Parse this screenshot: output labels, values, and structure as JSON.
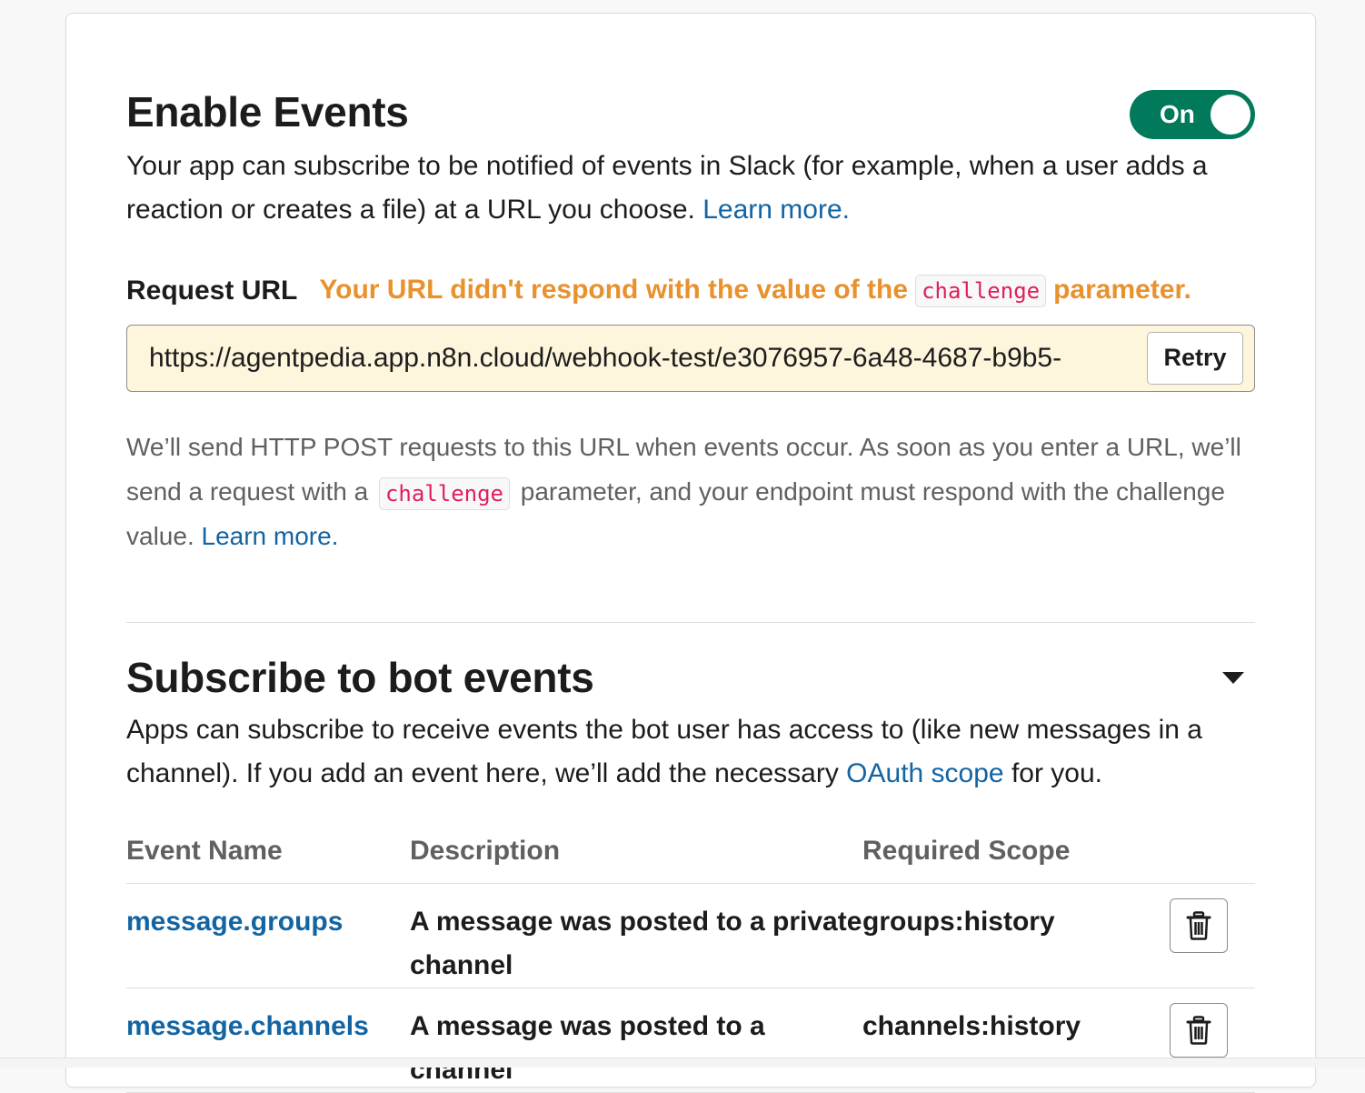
{
  "enable_events": {
    "title": "Enable Events",
    "toggle_label": "On",
    "desc_text": "Your app can subscribe to be notified of events in Slack (for example, when a user adds a reaction or creates a file) at a URL you choose.",
    "learn_more": "Learn more."
  },
  "request_url": {
    "label": "Request URL",
    "warning_before": "Your URL didn't respond with the value of the",
    "warning_code": "challenge",
    "warning_after": "parameter.",
    "value": "https://agentpedia.app.n8n.cloud/webhook-test/e3076957-6a48-4687-b9b5-",
    "retry_label": "Retry",
    "help_before": "We’ll send HTTP POST requests to this URL when events occur. As soon as you enter a URL, we’ll send a request with a",
    "help_code": "challenge",
    "help_after": "parameter, and your endpoint must respond with the challenge value.",
    "help_learn_more": "Learn more."
  },
  "bot_events": {
    "title": "Subscribe to bot events",
    "desc_before": "Apps can subscribe to receive events the bot user has access to (like new messages in a channel). If you add an event here, we’ll add the necessary",
    "desc_link": "OAuth scope",
    "desc_after": "for you.",
    "columns": [
      "Event Name",
      "Description",
      "Required Scope"
    ],
    "rows": [
      {
        "name": "message.groups",
        "description": "A message was posted to a private channel",
        "scope": "groups:history"
      },
      {
        "name": "message.channels",
        "description": "A message was posted to a channel",
        "scope": "channels:history"
      }
    ]
  },
  "colors": {
    "toggle_on": "#007a5a",
    "link": "#1264a3",
    "warning": "#e8912d",
    "code_text": "#e01e5a",
    "url_box_bg": "#fdf5dc"
  },
  "icons": {
    "delete": "trash-icon",
    "collapse": "caret-down-icon"
  }
}
